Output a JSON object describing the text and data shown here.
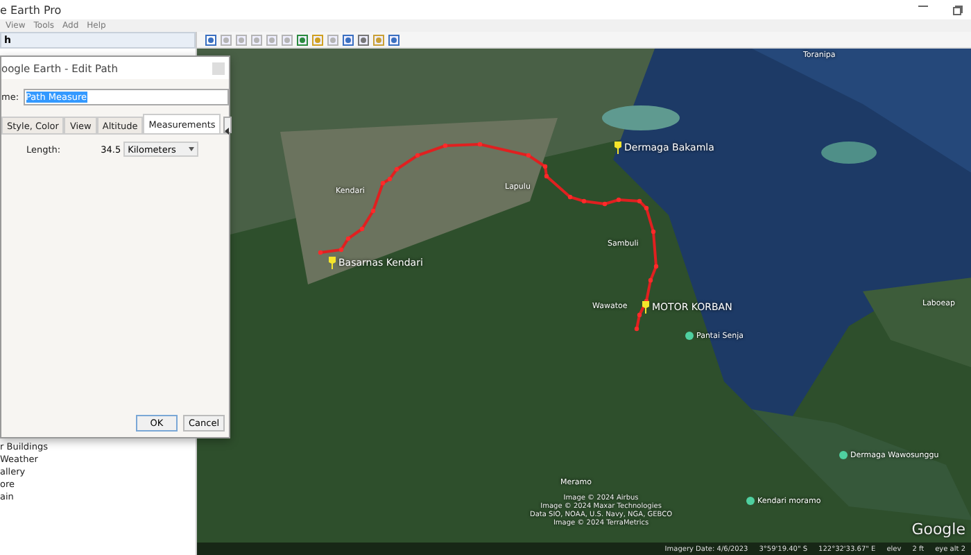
{
  "window": {
    "title": "e Earth Pro"
  },
  "menu": [
    "View",
    "Tools",
    "Add",
    "Help"
  ],
  "sidebar": {
    "header": "h",
    "layers": [
      "r Buildings",
      "Weather",
      "allery",
      "ore",
      "ain"
    ]
  },
  "dialog": {
    "title": "oogle Earth - Edit Path",
    "name_label": "me:",
    "name_value": "Path Measure",
    "tabs": [
      {
        "label": "Style, Color",
        "selected": false
      },
      {
        "label": "View",
        "selected": false
      },
      {
        "label": "Altitude",
        "selected": false
      },
      {
        "label": "Measurements",
        "selected": true
      }
    ],
    "length_label": "Length:",
    "length_value": "34.5",
    "unit": "Kilometers",
    "buttons": [
      "OK",
      "Cancel"
    ]
  },
  "map": {
    "places": [
      {
        "label": "Toranipa",
        "kind": "plain"
      },
      {
        "label": "Dermaga Bakamla",
        "kind": "pin"
      },
      {
        "label": "Lapulu",
        "kind": "plain"
      },
      {
        "label": "Kendari",
        "kind": "plain"
      },
      {
        "label": "Basarnas Kendari",
        "kind": "pin"
      },
      {
        "label": "Sambuli",
        "kind": "plain"
      },
      {
        "label": "Wawatoe",
        "kind": "plain"
      },
      {
        "label": "MOTOR KORBAN",
        "kind": "pin"
      },
      {
        "label": "Pantai Senja",
        "kind": "dot"
      },
      {
        "label": "Laboeap",
        "kind": "plain"
      },
      {
        "label": "Dermaga Wawosunggu",
        "kind": "dot"
      },
      {
        "label": "Meramo",
        "kind": "plain"
      },
      {
        "label": "Kendari moramo",
        "kind": "dot"
      }
    ],
    "credits": [
      "Image © 2024 Airbus",
      "Image © 2024 Maxar Technologies",
      "Data SIO, NOAA, U.S. Navy, NGA, GEBCO",
      "Image © 2024 TerraMetrics"
    ],
    "logo": "Google",
    "status": [
      "Imagery Date: 4/6/2023",
      "3°59'19.40\" S",
      "122°32'33.67\" E",
      "elev",
      "2 ft",
      "eye alt 2"
    ]
  }
}
